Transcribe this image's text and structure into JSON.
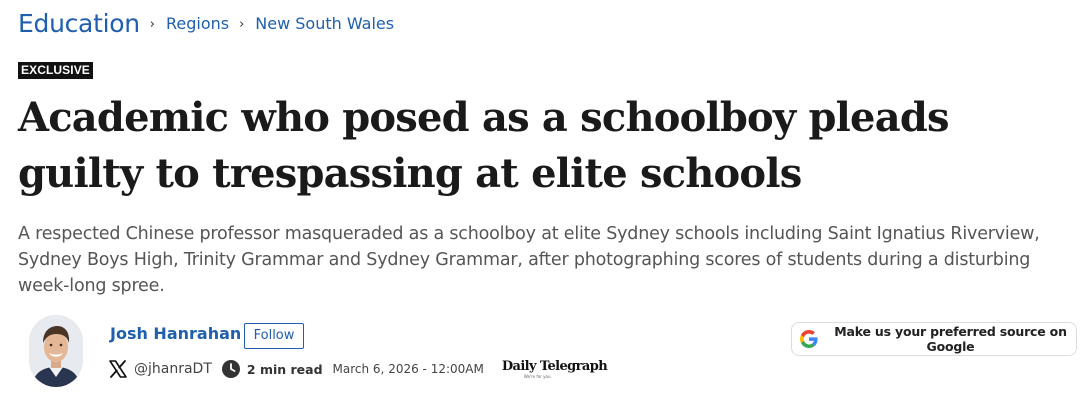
{
  "breadcrumb": {
    "section": "Education",
    "items": [
      "Regions",
      "New South Wales"
    ],
    "separator": "›"
  },
  "badge": "EXCLUSIVE",
  "headline": "Academic who posed as a schoolboy pleads guilty to trespassing at elite schools",
  "standfirst": "A respected Chinese professor masqueraded as a schoolboy at elite Sydney schools including Saint Ignatius Riverview, Sydney Boys High, Trinity Grammar and Sydney Grammar, after photographing scores of students during a disturbing week-long spree.",
  "author": {
    "name": "Josh Hanrahan",
    "follow_label": "Follow",
    "handle": "@jhanraDT",
    "social_icon": "x-logo-icon"
  },
  "meta": {
    "read_time": "2 min read",
    "date": "March 6, 2026 - 12:00AM",
    "clock_icon": "clock-icon"
  },
  "masthead": {
    "name": "Daily Telegraph",
    "tagline": "We're for you"
  },
  "google_button": {
    "label": "Make us your preferred source on Google",
    "icon": "google-g-icon"
  },
  "colors": {
    "link": "#1f5fae",
    "text": "#1a1a1a",
    "muted": "#555555",
    "badge_bg": "#111111"
  }
}
